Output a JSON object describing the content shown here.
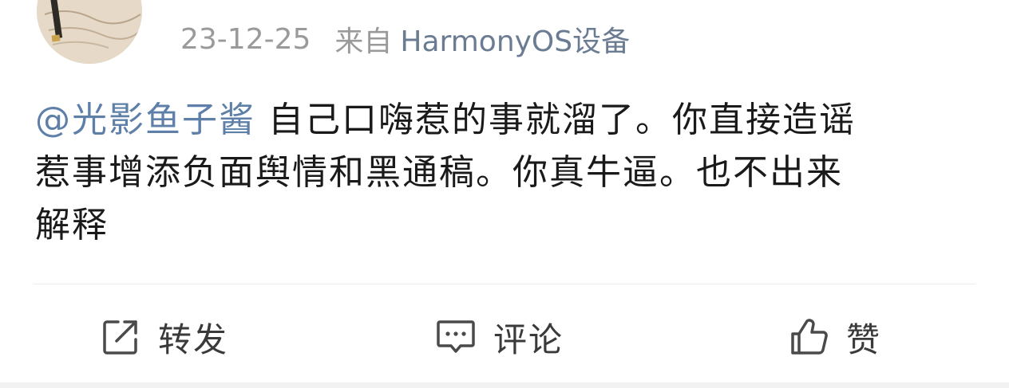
{
  "post": {
    "date": "23-12-25",
    "source_prefix": "来自",
    "source_device": "HarmonyOS设备",
    "mention": "@光影鱼子酱",
    "text_line1": " 自己口嗨惹的事就溜了。你直接造谣",
    "text_line2": "惹事增添负面舆情和黑通稿。你真牛逼。也不出来",
    "text_line3": "解释"
  },
  "actions": {
    "forward_label": "转发",
    "comment_label": "评论",
    "like_label": "赞"
  },
  "icons": {
    "forward": "share-box-icon",
    "comment": "comment-bubble-icon",
    "like": "thumbs-up-icon"
  },
  "colors": {
    "mention": "#5e7fa8",
    "meta_gray": "#9a9a9a",
    "device_link": "#6b7c92",
    "body_text": "#1a1a1a",
    "action_text": "#3a3a3a"
  }
}
